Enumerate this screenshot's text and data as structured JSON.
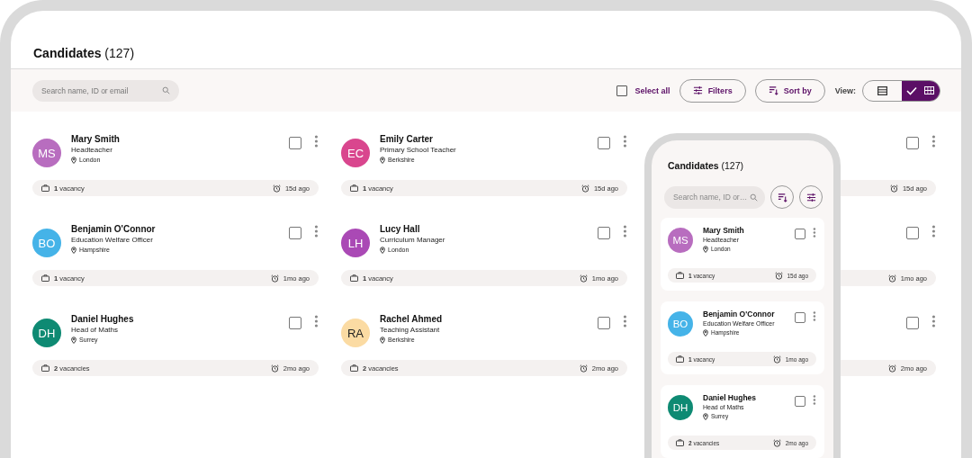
{
  "header": {
    "title": "**Candidates** (127)"
  },
  "toolbar": {
    "search": {
      "placeholder": "Search name, ID or email"
    },
    "select_all": {
      "label": "Select all",
      "checked": false
    },
    "filters_button": "Filters",
    "sort_button": "Sort by",
    "view_label": "View:",
    "view_options": [
      {
        "kind": "list",
        "selected": false
      },
      {
        "kind": "grid",
        "selected": true
      }
    ]
  },
  "cards": [
    {
      "initials": "MS",
      "color": "#b86dbf",
      "name": "Mary Smith",
      "role": "Headteacher",
      "location": "London",
      "checked": false,
      "vacancies": "**1** vacancy",
      "time": "15d ago"
    },
    {
      "initials": "EC",
      "color": "#d9468e",
      "name": "Emily Carter",
      "role": "Primary School Teacher",
      "location": "Berkshire",
      "checked": false,
      "vacancies": "**1** vacancy",
      "time": "15d ago"
    },
    {
      "checked": false,
      "time": "15d ago"
    },
    {
      "initials": "BO",
      "color": "#45b3e8",
      "name": "Benjamin O'Connor",
      "role": "Education Welfare Officer",
      "location": "Hampshire",
      "checked": false,
      "vacancies": "**1** vacancy",
      "time": "1mo ago"
    },
    {
      "initials": "LH",
      "color": "#aa49b5",
      "name": "Lucy Hall",
      "role": "Curriculum Manager",
      "location": "London",
      "checked": false,
      "vacancies": "**1** vacancy",
      "time": "1mo ago"
    },
    {
      "checked": false,
      "time": "1mo ago"
    },
    {
      "initials": "DH",
      "color": "#0e8a73",
      "name": "Daniel Hughes",
      "role": "Head of Maths",
      "location": "Surrey",
      "checked": false,
      "vacancies": "**2** vacancies",
      "time": "2mo ago"
    },
    {
      "initials": "RA",
      "color": "#fbdba3",
      "name": "Rachel Ahmed",
      "role": "Teaching Assistant",
      "location": "Berkshire",
      "checked": false,
      "vacancies": "**2** vacancies",
      "time": "2mo ago"
    },
    {
      "checked": false,
      "time": "2mo ago"
    }
  ],
  "phone": {
    "title": "**Candidates** (127)",
    "search": {
      "placeholder": "Search name, ID or…"
    },
    "cards": [
      {
        "initials": "MS",
        "color": "#b86dbf",
        "name": "Mary Smith",
        "role": "Headteacher",
        "location": "London",
        "checked": false,
        "vacancies": "**1** vacancy",
        "time": "15d ago"
      },
      {
        "initials": "BO",
        "color": "#45b3e8",
        "name": "Benjamin O'Connor",
        "role": "Education Welfare Officer",
        "location": "Hampshire",
        "checked": false,
        "vacancies": "**1** vacancy",
        "time": "1mo ago"
      },
      {
        "initials": "DH",
        "color": "#0e8a73",
        "name": "Daniel Hughes",
        "role": "Head of Maths",
        "location": "Surrey",
        "checked": false,
        "vacancies": "**2** vacancies",
        "time": "2mo ago"
      }
    ]
  }
}
